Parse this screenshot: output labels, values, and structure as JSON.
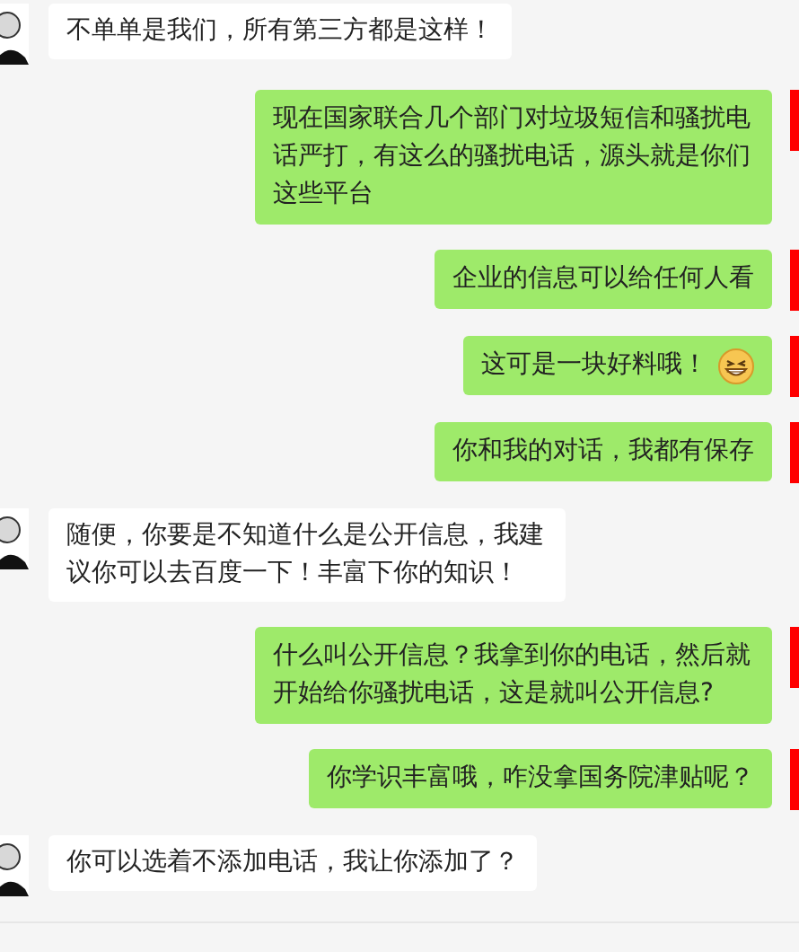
{
  "messages": [
    {
      "kind": "received",
      "text": "不单单是我们，所有第三方都是这样！"
    },
    {
      "kind": "sent",
      "text": "现在国家联合几个部门对垃圾短信和骚扰电话严打，有这么的骚扰电话，源头就是你们这些平台"
    },
    {
      "kind": "sent",
      "text": "企业的信息可以给任何人看"
    },
    {
      "kind": "sent",
      "text": "这可是一块好料哦！",
      "sticker": {
        "kind": "emoji"
      }
    },
    {
      "kind": "sent",
      "text": "你和我的对话，我都有保存"
    },
    {
      "kind": "received",
      "text": "随便，你要是不知道什么是公开信息，我建议你可以去百度一下！丰富下你的知识！"
    },
    {
      "kind": "sent",
      "text": "什么叫公开信息？我拿到你的电话，然后就开始给你骚扰电话，这是就叫公开信息?"
    },
    {
      "kind": "sent",
      "text": "你学识丰富哦，咋没拿国务院津贴呢？"
    },
    {
      "kind": "received",
      "text": "你可以选着不添加电话，我让你添加了？"
    }
  ]
}
